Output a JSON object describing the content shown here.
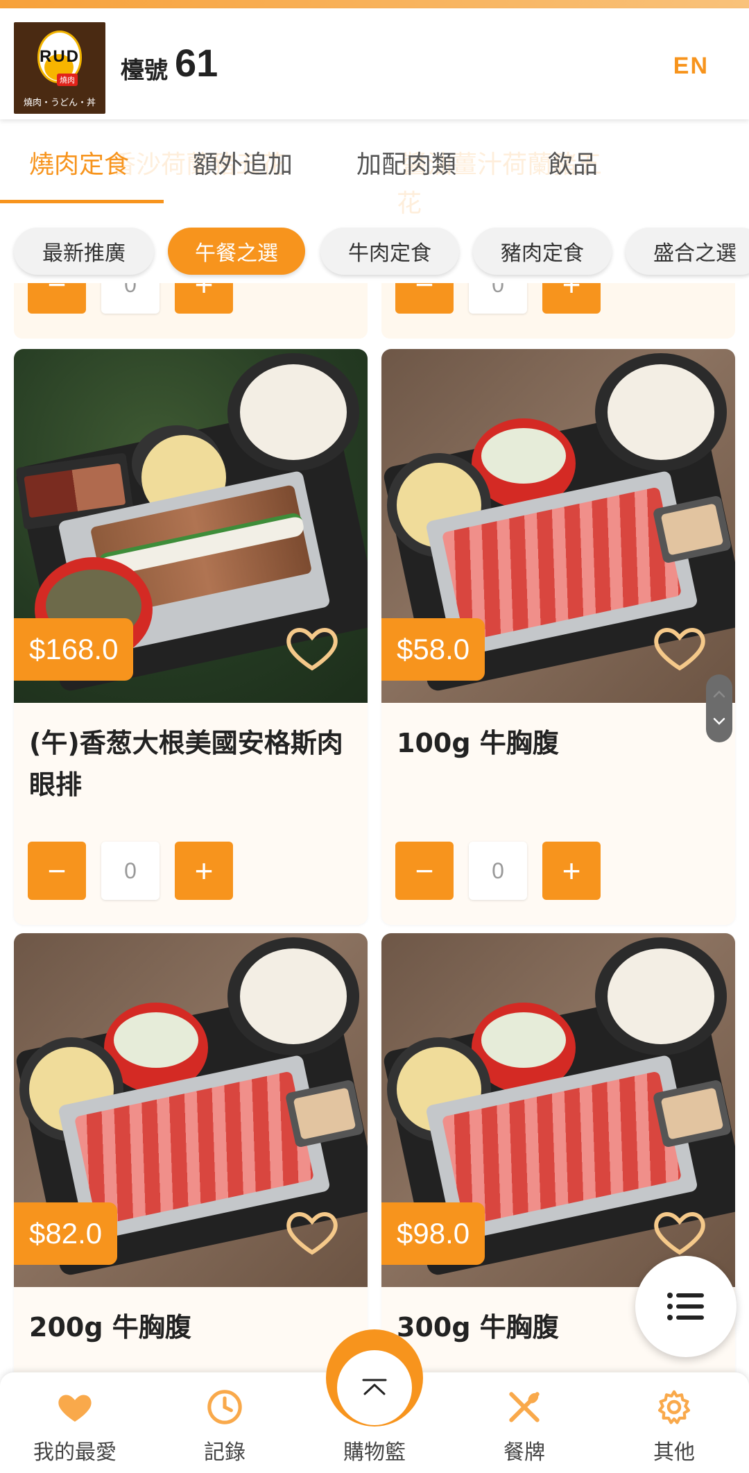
{
  "header": {
    "logo_letters": "RUD",
    "logo_tag": "燒肉",
    "logo_sub": "燒肉・うどん・丼",
    "table_label": "檯號",
    "table_number": "61",
    "language_button": "EN"
  },
  "tabs": {
    "ghost_labels": [
      "香沙荷蘭豬五花",
      "醬油薑汁荷蘭豬五",
      "花"
    ],
    "items": [
      {
        "label": "燒肉定食",
        "active": true
      },
      {
        "label": "額外追加",
        "active": false
      },
      {
        "label": "加配肉類",
        "active": false
      },
      {
        "label": "飲品",
        "active": false
      }
    ]
  },
  "chips": [
    {
      "label": "最新推廣",
      "active": false
    },
    {
      "label": "午餐之選",
      "active": true
    },
    {
      "label": "牛肉定食",
      "active": false
    },
    {
      "label": "豬肉定食",
      "active": false
    },
    {
      "label": "盛合之選",
      "active": false
    }
  ],
  "products": [
    {
      "name": "(午)香葱大根美國安格斯肉眼排",
      "price": "$168.0",
      "quantity": "0"
    },
    {
      "name": "100g 牛胸腹",
      "price": "$58.0",
      "quantity": "0"
    },
    {
      "name": "200g 牛胸腹",
      "price": "$82.0",
      "quantity": "0"
    },
    {
      "name": "300g 牛胸腹",
      "price": "$98.0",
      "quantity": "0"
    }
  ],
  "partial_prev_row": {
    "quantity": "0"
  },
  "bottom_nav": {
    "items": [
      {
        "label": "我的最愛",
        "icon": "heart-icon"
      },
      {
        "label": "記錄",
        "icon": "clock-icon"
      },
      {
        "label": "購物籃",
        "icon": "chevron-up-icon"
      },
      {
        "label": "餐牌",
        "icon": "fork-knife-icon"
      },
      {
        "label": "其他",
        "icon": "gear-icon"
      }
    ]
  },
  "colors": {
    "accent": "#f7941d",
    "card_bg": "#fffaf4"
  }
}
